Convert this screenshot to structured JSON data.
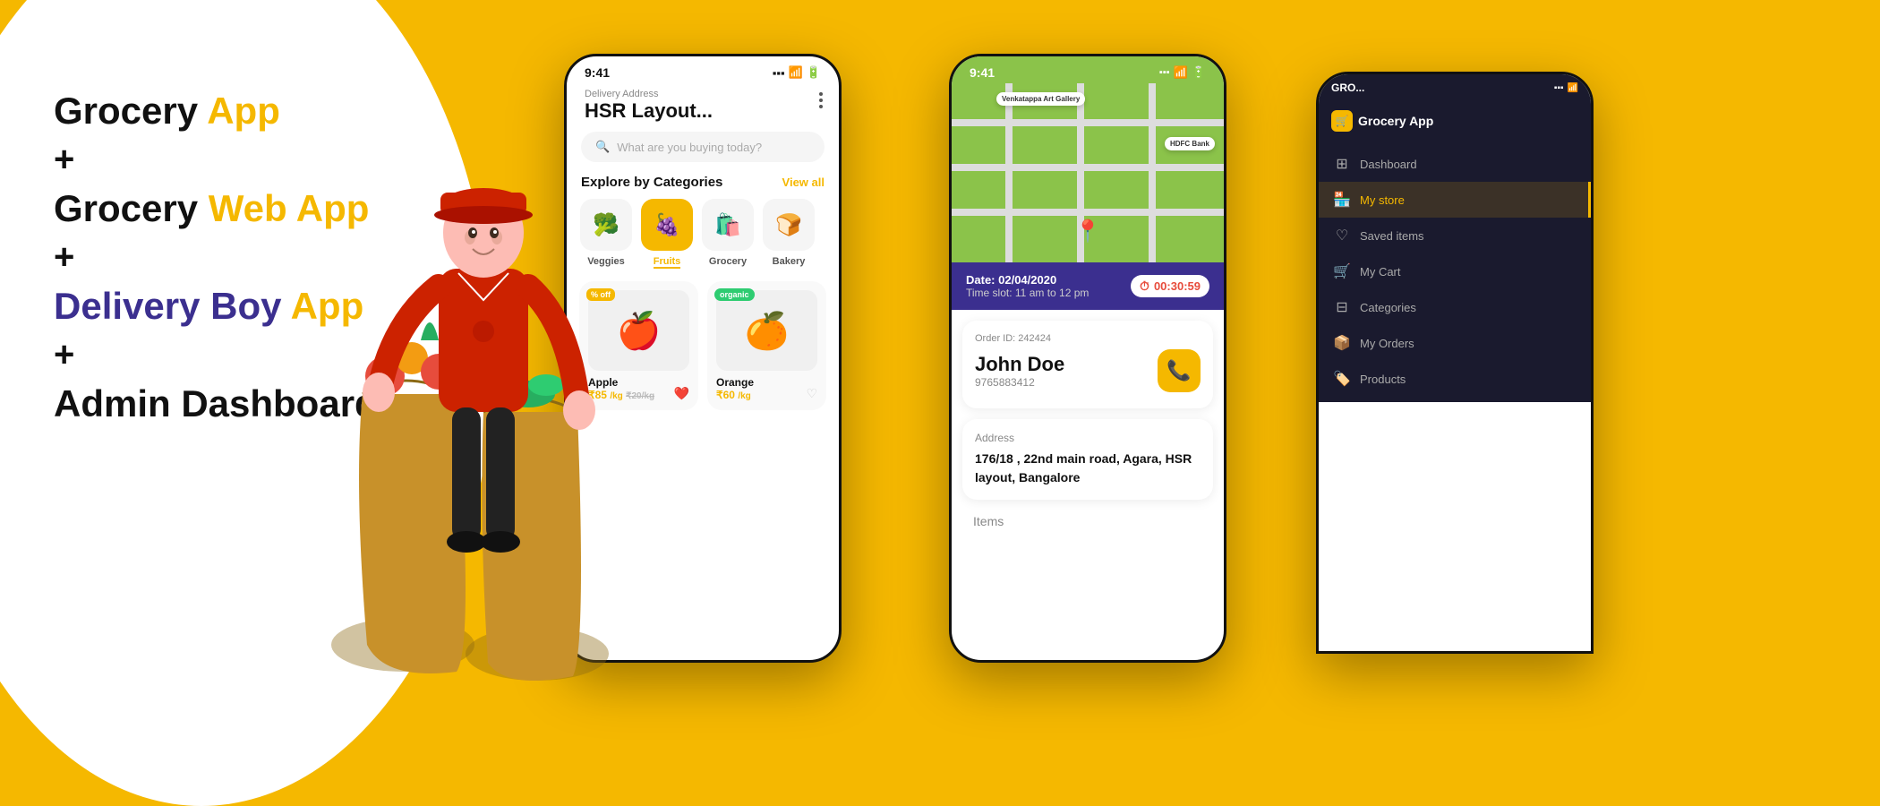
{
  "page": {
    "bg_color": "#F5B800"
  },
  "left": {
    "line1": "Grocery ",
    "line1_colored": "App",
    "plus1": "+",
    "line2": "Grocery ",
    "line2_colored": "Web App",
    "plus2": "+",
    "line3_colored": "Delivery Boy ",
    "line3": "App",
    "plus3": "+",
    "line4": "Admin Dashboard"
  },
  "phone1": {
    "status_time": "9:41",
    "delivery_label": "Delivery Address",
    "address": "HSR Layout...",
    "search_placeholder": "What are you buying today?",
    "section_title": "Explore by Categories",
    "view_all": "View all",
    "categories": [
      {
        "name": "Veggies",
        "icon": "🥦",
        "active": false
      },
      {
        "name": "Fruits",
        "icon": "🍇",
        "active": true
      },
      {
        "name": "Grocery",
        "icon": "🛍️",
        "active": false
      },
      {
        "name": "Bakery",
        "icon": "🍞",
        "active": false
      }
    ],
    "products": [
      {
        "name": "Apple",
        "price": "₹85",
        "unit": "/kg",
        "old_price": "₹20/kg",
        "badge": "% off",
        "icon": "🍎",
        "liked": true
      },
      {
        "name": "Orange",
        "price": "₹60",
        "unit": "/kg",
        "badge": "organic",
        "icon": "🍊",
        "liked": false
      }
    ]
  },
  "phone2": {
    "status_time": "9:41",
    "date": "Date: 02/04/2020",
    "timeslot": "Time slot: 11 am to 12 pm",
    "timer": "00:30:59",
    "order_id": "Order ID: 242424",
    "customer_name": "John Doe",
    "customer_phone": "9765883412",
    "address_label": "Address",
    "address": "176/18 , 22nd main road, Agara, HSR layout, Bangalore",
    "items_label": "Items",
    "map": {
      "label1": "Venkatappa Art Gallery",
      "label2": "HDFC Bank"
    }
  },
  "phone3": {
    "logo": "Grocery App",
    "nav_items": [
      {
        "label": "Dashboard",
        "icon": "⊞",
        "active": false
      },
      {
        "label": "My store",
        "icon": "🏪",
        "active": true
      },
      {
        "label": "Saved items",
        "icon": "♡",
        "active": false
      },
      {
        "label": "My Cart",
        "icon": "🛒",
        "active": false
      },
      {
        "label": "Categories",
        "icon": "⊟",
        "active": false
      },
      {
        "label": "My Orders",
        "icon": "📦",
        "active": false
      },
      {
        "label": "Products",
        "icon": "🏷️",
        "active": false
      }
    ]
  }
}
